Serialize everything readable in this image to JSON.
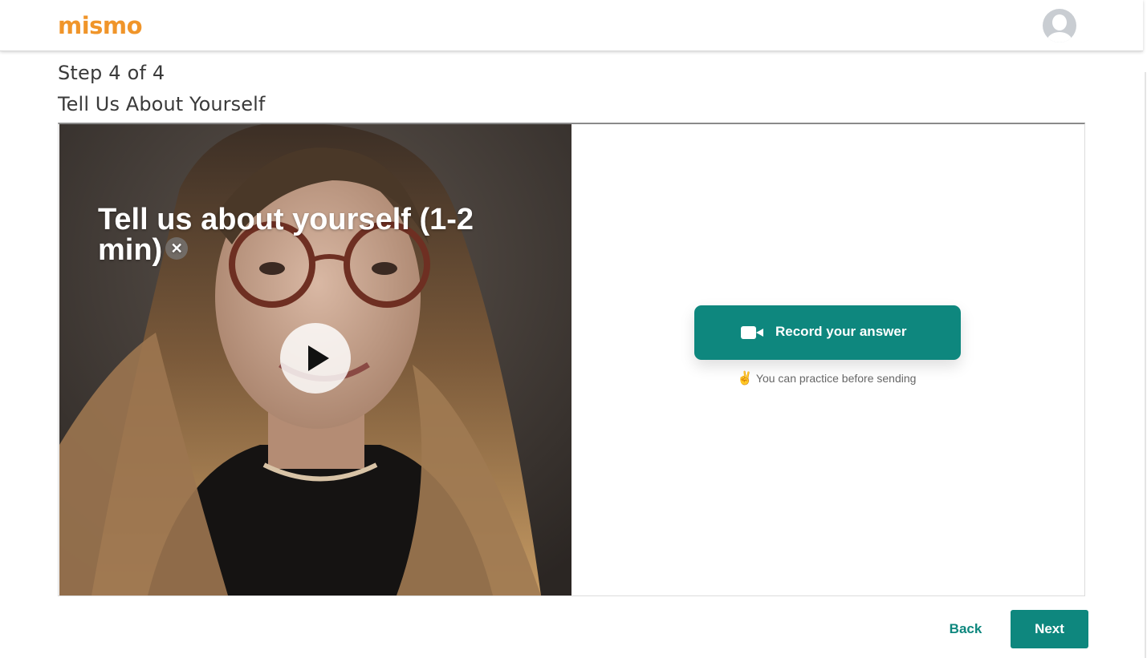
{
  "header": {
    "logo_text": "mismo",
    "avatar_icon": "user-avatar-icon"
  },
  "step": {
    "counter": "Step 4 of 4",
    "title": "Tell Us About Yourself"
  },
  "video": {
    "question": "Tell us about yourself (1-2 min)",
    "close_glyph": "✕",
    "play_icon": "play-icon"
  },
  "answer": {
    "record_label": "Record your answer",
    "record_icon": "video-camera-icon",
    "hint_emoji": "✌",
    "hint_text": "You can practice before sending"
  },
  "footer": {
    "back_label": "Back",
    "next_label": "Next"
  },
  "colors": {
    "brand_orange": "#f0952a",
    "accent_teal": "#0e877e"
  }
}
